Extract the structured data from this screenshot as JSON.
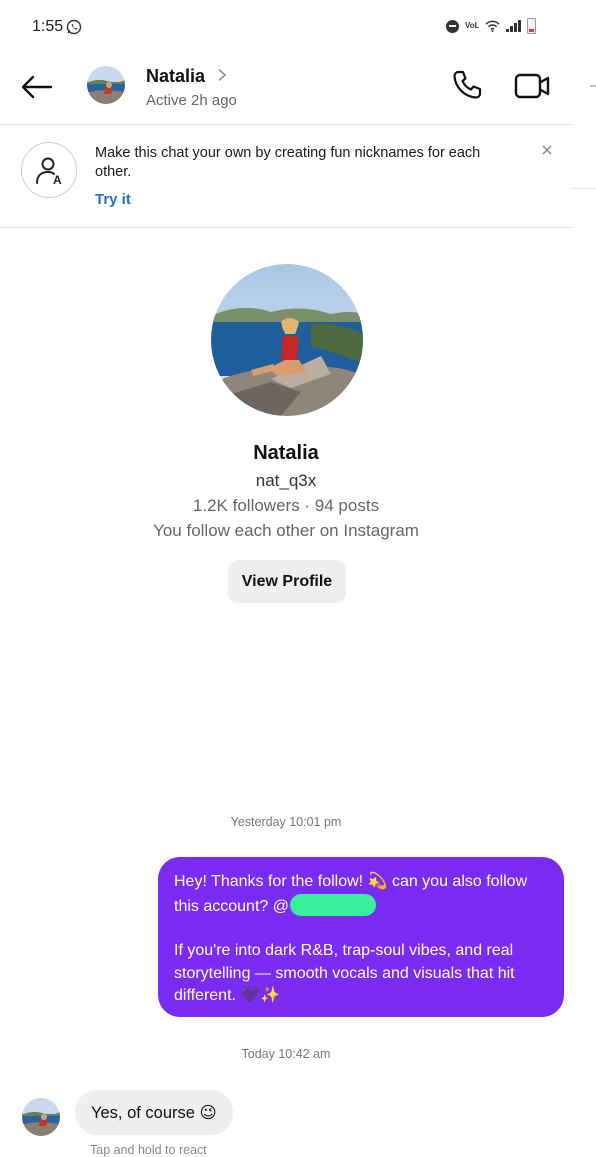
{
  "status_bar": {
    "time": "1:55",
    "network_label": "VoLTE",
    "icons": [
      "whatsapp-icon",
      "do-not-disturb-icon",
      "volte-icon",
      "wifi-icon",
      "signal-icon",
      "battery-low-icon"
    ]
  },
  "header": {
    "contact_name": "Natalia",
    "active_status": "Active 2h ago",
    "icons": [
      "back-arrow-icon",
      "chevron-right-icon",
      "phone-call-icon",
      "video-call-icon"
    ]
  },
  "banner": {
    "text": "Make this chat your own by creating fun nicknames for each other.",
    "cta": "Try it",
    "icons": [
      "nickname-person-icon",
      "close-icon"
    ]
  },
  "profile": {
    "name": "Natalia",
    "handle": "nat_q3x",
    "stats": "1.2K followers · 94 posts",
    "mutual": "You follow each other on Instagram",
    "view_button": "View Profile"
  },
  "messages": [
    {
      "timestamp": "Yesterday 10:01 pm",
      "direction": "outgoing",
      "line1": "Hey! Thanks for the follow! 💫 can you also follow this account? @",
      "line2": "If you're into dark R&B, trap-soul vibes, and real storytelling — smooth vocals and visuals that hit different.",
      "trailing_emoji": "🖤",
      "trailing_emoji2": "✨"
    },
    {
      "timestamp": "Today 10:42 am",
      "direction": "incoming",
      "text": "Yes, of course 😉",
      "react_hint": "Tap and hold to react"
    }
  ],
  "colors": {
    "outgoing_bubble": "#7a2cf2",
    "incoming_bubble": "#efefef",
    "link_blue": "#1a73c7",
    "redaction": "#37ef9d"
  }
}
